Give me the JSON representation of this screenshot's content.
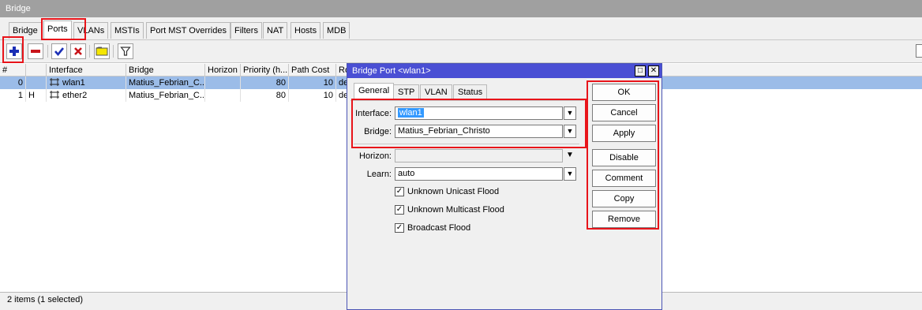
{
  "window": {
    "title": "Bridge"
  },
  "tabs": [
    {
      "label": "Bridge"
    },
    {
      "label": "Ports"
    },
    {
      "label": "VLANs"
    },
    {
      "label": "MSTIs"
    },
    {
      "label": "Port MST Overrides"
    },
    {
      "label": "Filters"
    },
    {
      "label": "NAT"
    },
    {
      "label": "Hosts"
    },
    {
      "label": "MDB"
    }
  ],
  "toolbar": {
    "add": "plus-icon",
    "remove": "minus-icon",
    "enable": "check-icon",
    "disable": "cross-icon",
    "comment": "comment-icon",
    "filter": "filter-icon",
    "colors": {
      "add": "#1b2fb5",
      "remove": "#c8141a",
      "enable": "#1b2fb5",
      "disable": "#c8141a"
    }
  },
  "table": {
    "columns": [
      "#",
      "",
      "Interface",
      "Bridge",
      "Horizon",
      "Priority (h...",
      "Path Cost",
      "Ro"
    ],
    "rows": [
      {
        "num": "0",
        "flag": "",
        "interface": "wlan1",
        "bridge": "Matius_Febrian_C...",
        "horizon": "",
        "priority": "80",
        "path_cost": "10",
        "role": "de",
        "selected": true
      },
      {
        "num": "1",
        "flag": "H",
        "interface": "ether2",
        "bridge": "Matius_Febrian_C...",
        "horizon": "",
        "priority": "80",
        "path_cost": "10",
        "role": "de",
        "selected": false
      }
    ]
  },
  "status": {
    "text": "2 items (1 selected)"
  },
  "dialog": {
    "title": "Bridge Port <wlan1>",
    "tabs": [
      "General",
      "STP",
      "VLAN",
      "Status"
    ],
    "interface_label": "Interface:",
    "interface_value": "wlan1",
    "bridge_label": "Bridge:",
    "bridge_value": "Matius_Febrian_Christo",
    "horizon_label": "Horizon:",
    "horizon_value": "",
    "learn_label": "Learn:",
    "learn_value": "auto",
    "checkboxes": [
      {
        "label": "Unknown Unicast Flood",
        "checked": true
      },
      {
        "label": "Unknown Multicast Flood",
        "checked": true
      },
      {
        "label": "Broadcast Flood",
        "checked": true
      }
    ],
    "buttons": {
      "ok": "OK",
      "cancel": "Cancel",
      "apply": "Apply",
      "disable": "Disable",
      "comment": "Comment",
      "copy": "Copy",
      "remove": "Remove"
    }
  },
  "colors": {
    "highlight": "#e8141a",
    "selection": "#9bbce8",
    "dialog_title": "#4a4fd4"
  }
}
